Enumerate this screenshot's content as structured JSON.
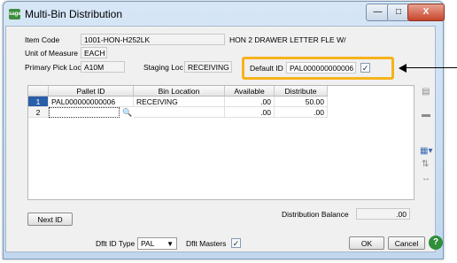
{
  "window": {
    "title": "Multi-Bin Distribution",
    "app_icon": "sage",
    "minimize": "—",
    "maximize": "□",
    "close": "X"
  },
  "header": {
    "item_code_label": "Item Code",
    "item_code": "1001-HON-H252LK",
    "item_desc": "HON 2 DRAWER LETTER FLE W/",
    "uom_label": "Unit of Measure",
    "uom": "EACH",
    "pick_loc_label": "Primary Pick Loc",
    "pick_loc": "A10M",
    "staging_label": "Staging Loc",
    "staging": "RECEIVING",
    "default_id_label": "Default ID",
    "default_id": "PAL000000000006",
    "default_id_checked": "✓"
  },
  "grid": {
    "columns": [
      "Pallet ID",
      "Bin Location",
      "Available",
      "Distribute"
    ],
    "rows": [
      {
        "num": "1",
        "pallet": "PAL000000000006",
        "bin": "RECEIVING",
        "available": ".00",
        "distribute": "50.00"
      },
      {
        "num": "2",
        "pallet": "",
        "bin": "",
        "available": ".00",
        "distribute": ".00"
      }
    ],
    "lookup_icon": "magnifier"
  },
  "footer": {
    "next_id": "Next ID",
    "balance_label": "Distribution Balance",
    "balance": ".00",
    "dflt_type_label": "Dflt ID Type",
    "dflt_type": "PAL",
    "dflt_masters_label": "Dflt Masters",
    "dflt_masters_checked": "✓",
    "ok": "OK",
    "cancel": "Cancel",
    "help": "?"
  },
  "colors": {
    "accent_highlight": "#f6b31c",
    "selected_row": "#2a5ea8",
    "help": "#2f8f3a"
  }
}
